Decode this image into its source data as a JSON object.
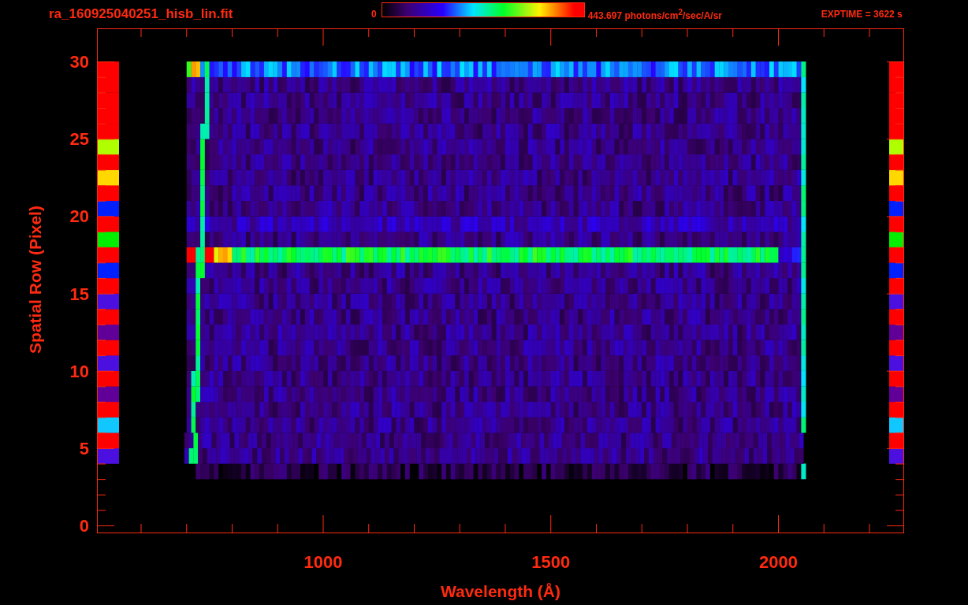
{
  "header": {
    "file_name": "ra_160925040251_hisb_lin.fit",
    "colorbar_min": "0",
    "colorbar_max": "443.697 photons/cm$^{2}$/sec/A/sr",
    "exptime": "EXPTIME = 3622 s"
  },
  "plot": {
    "ylabel": "Spatial Row (Pixel)",
    "xlabel": "Wavelength (Å)",
    "yticks": [
      "30",
      "25",
      "20",
      "15",
      "10",
      "5",
      "0"
    ],
    "xticks": [
      "1000",
      "1500",
      "2000"
    ]
  }
}
